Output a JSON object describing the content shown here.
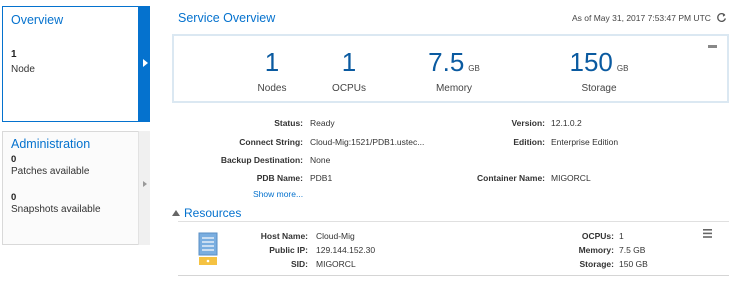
{
  "overview_card": {
    "title": "Overview",
    "count": "1",
    "label": "Node"
  },
  "admin_card": {
    "title": "Administration",
    "items": [
      {
        "count": "0",
        "label": "Patches available"
      },
      {
        "count": "0",
        "label": "Snapshots available"
      }
    ]
  },
  "service": {
    "title": "Service Overview",
    "as_of": "As of May 31, 2017 7:53:47 PM UTC"
  },
  "metrics": [
    {
      "value": "1",
      "unit": "",
      "label": "Nodes"
    },
    {
      "value": "1",
      "unit": "",
      "label": "OCPUs"
    },
    {
      "value": "7.5",
      "unit": "GB",
      "label": "Memory"
    },
    {
      "value": "150",
      "unit": "GB",
      "label": "Storage"
    }
  ],
  "details": {
    "status_label": "Status:",
    "status_value": "Ready",
    "connect_label": "Connect String:",
    "connect_value": "Cloud-Mig:1521/PDB1.ustec...",
    "backup_label": "Backup Destination:",
    "backup_value": "None",
    "pdb_label": "PDB Name:",
    "pdb_value": "PDB1",
    "version_label": "Version:",
    "version_value": "12.1.0.2",
    "edition_label": "Edition:",
    "edition_value": "Enterprise Edition",
    "container_label": "Container Name:",
    "container_value": "MIGORCL",
    "show_more": "Show more..."
  },
  "resources": {
    "title": "Resources",
    "host_label": "Host Name:",
    "host_value": "Cloud-Mig",
    "ip_label": "Public IP:",
    "ip_value": "129.144.152.30",
    "sid_label": "SID:",
    "sid_value": "MIGORCL",
    "ocpus_label": "OCPUs:",
    "ocpus_value": "1",
    "memory_label": "Memory:",
    "memory_value": "7.5 GB",
    "storage_label": "Storage:",
    "storage_value": "150 GB"
  },
  "colors": {
    "accent": "#0572ce",
    "metric": "#0a5aa0",
    "server_icon": "#7aaee0",
    "server_badge": "#f5c242"
  },
  "icons": {
    "refresh": "refresh-icon",
    "collapse": "collapse-icon",
    "menu": "hamburger-menu-icon",
    "server": "server-icon",
    "expand": "triangle-down-icon",
    "card_arrow": "chevron-right-icon"
  }
}
